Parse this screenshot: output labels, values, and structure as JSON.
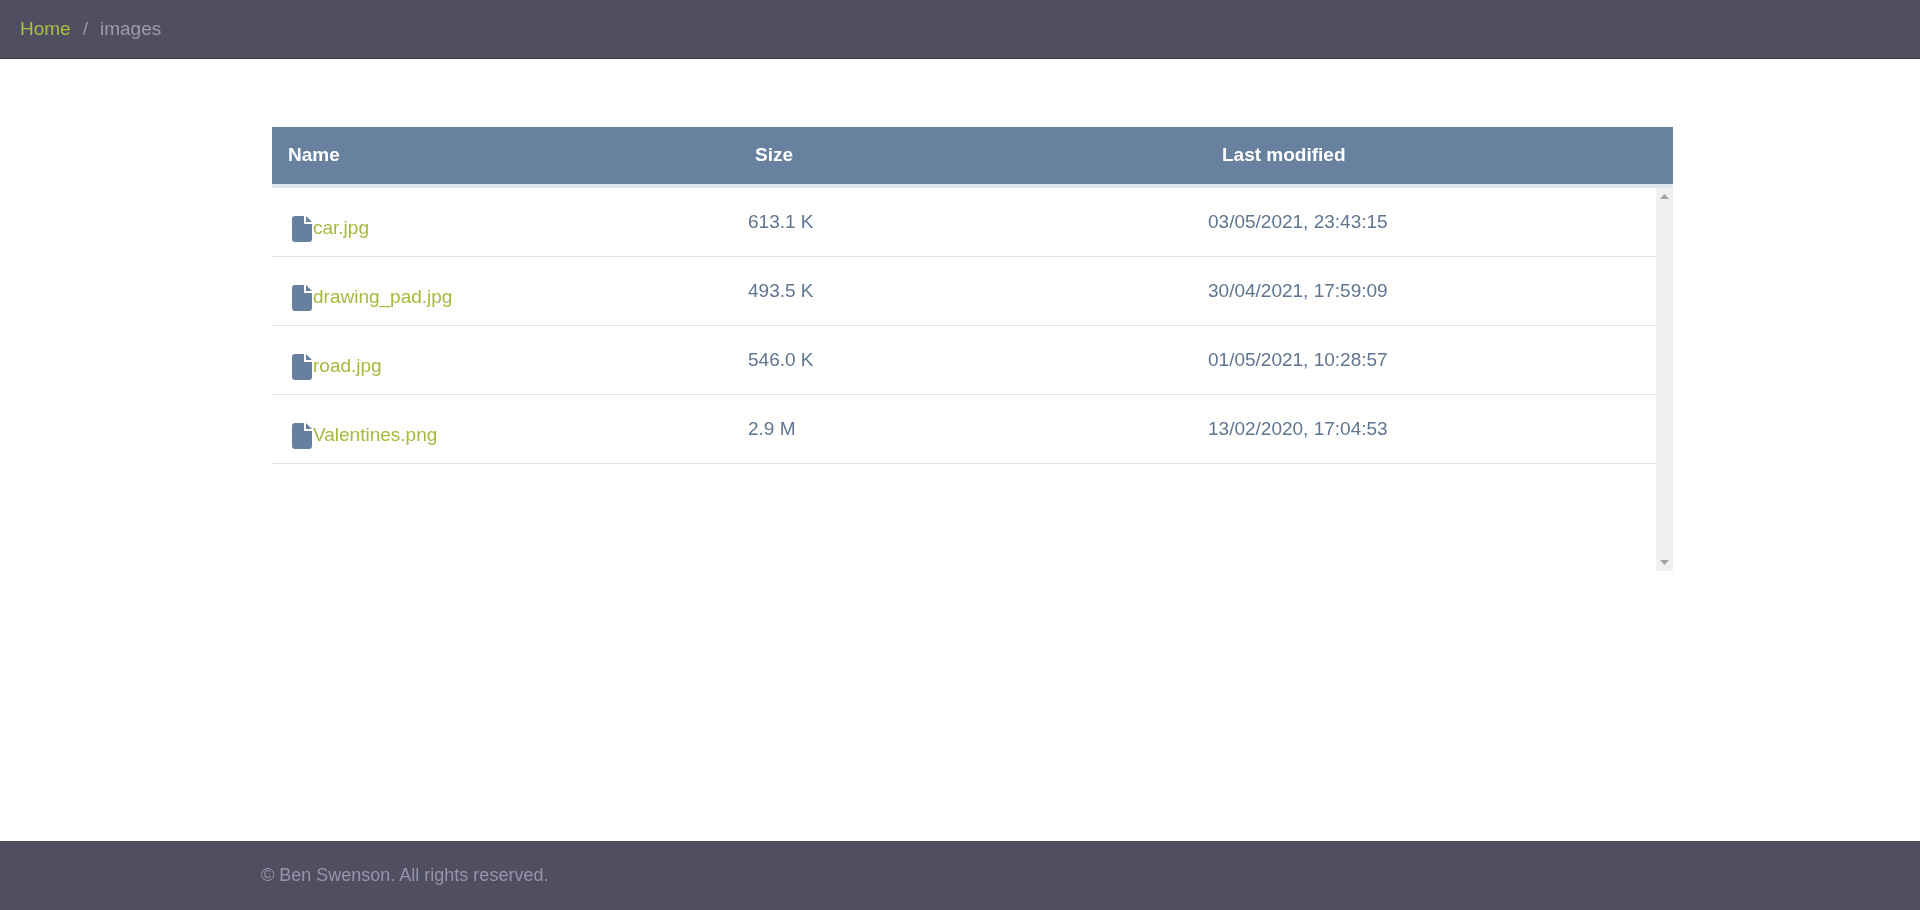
{
  "breadcrumb": [
    {
      "label": "Home",
      "current": false
    },
    {
      "label": "/",
      "kind": "separator"
    },
    {
      "label": "images",
      "current": true
    }
  ],
  "table": {
    "columns": [
      "Name",
      "Size",
      "Last modified"
    ],
    "rows": [
      {
        "name": "car.jpg",
        "size": "613.1 K",
        "modified": "03/05/2021, 23:43:15"
      },
      {
        "name": "drawing_pad.jpg",
        "size": "493.5 K",
        "modified": "30/04/2021, 17:59:09"
      },
      {
        "name": "road.jpg",
        "size": "546.0 K",
        "modified": "01/05/2021, 10:28:57"
      },
      {
        "name": "Valentines.png",
        "size": "2.9 M",
        "modified": "13/02/2020, 17:04:53"
      }
    ]
  },
  "footer": {
    "text": "© Ben Swenson. All rights reserved."
  }
}
